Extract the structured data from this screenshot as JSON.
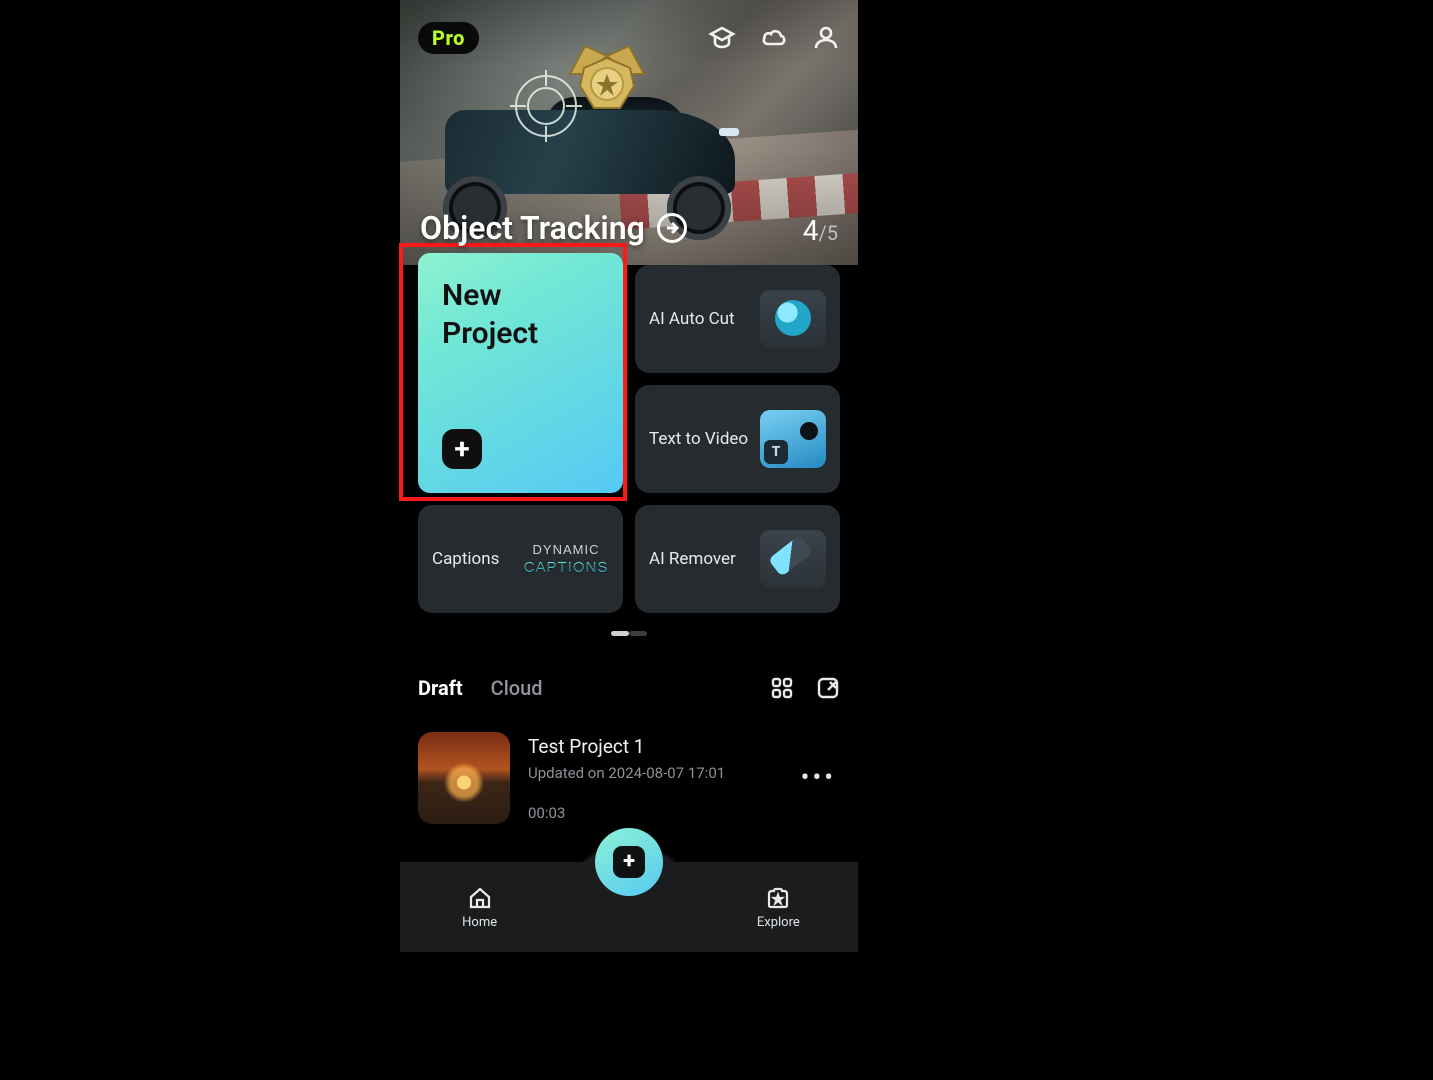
{
  "header": {
    "pro_label": "Pro"
  },
  "hero": {
    "title": "Object Tracking",
    "page_current": "4",
    "page_separator": "/",
    "page_total": "5"
  },
  "tiles": {
    "new_project_label": "New\nProject",
    "items": [
      {
        "label": "AI Auto Cut"
      },
      {
        "label": "Text to Video"
      },
      {
        "label": "Captions",
        "badge_line1": "DYNAMIC",
        "badge_line2": "CAPTIONS"
      },
      {
        "label": "AI Remover"
      }
    ]
  },
  "drafts": {
    "tabs": [
      {
        "label": "Draft",
        "active": true
      },
      {
        "label": "Cloud",
        "active": false
      }
    ],
    "project": {
      "name": "Test Project 1",
      "updated": "Updated on 2024-08-07 17:01",
      "duration": "00:03"
    }
  },
  "nav": {
    "home_label": "Home",
    "explore_label": "Explore"
  }
}
